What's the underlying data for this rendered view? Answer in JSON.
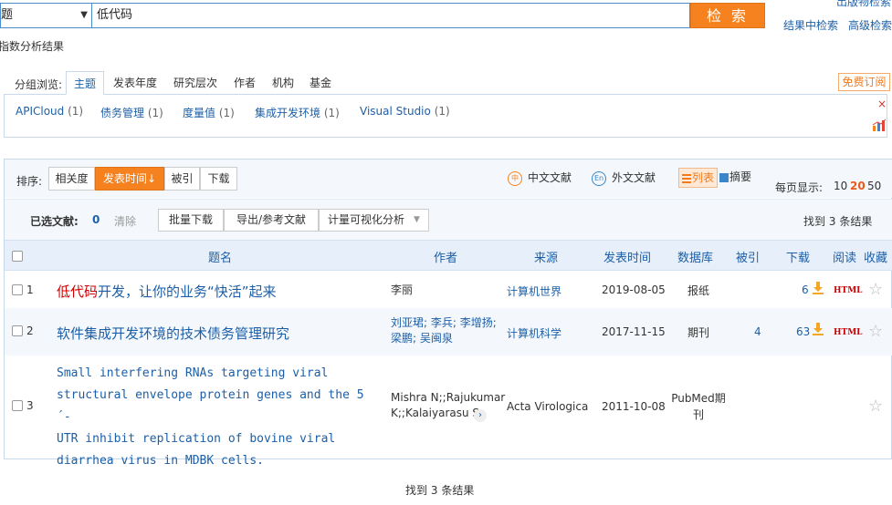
{
  "search": {
    "field": "题",
    "query": "低代码",
    "button": "检 索",
    "top_right": "出版物检索",
    "in_results": "结果中检索",
    "advanced": "高级检索",
    "analysis": "指数分析结果"
  },
  "group": {
    "label": "分组浏览:",
    "tabs": [
      "主题",
      "发表年度",
      "研究层次",
      "作者",
      "机构",
      "基金"
    ],
    "items": [
      {
        "name": "APICloud",
        "count": "(1)"
      },
      {
        "name": "债务管理",
        "count": "(1)"
      },
      {
        "name": "度量值",
        "count": "(1)"
      },
      {
        "name": "集成开发环境",
        "count": "(1)"
      },
      {
        "name": "Visual Studio",
        "count": "(1)"
      }
    ],
    "subscribe": "免费订阅",
    "close": "×"
  },
  "sort": {
    "label": "排序:",
    "options": [
      "相关度",
      "发表时间",
      "被引",
      "下载"
    ],
    "active_arrow": "↓",
    "cn_docs": "中文文献",
    "en_docs": "外文文献",
    "view_list": "列表",
    "view_summary": "摘要",
    "per_page_label": "每页显示:",
    "per_page": [
      "10",
      "20",
      "50"
    ]
  },
  "batch": {
    "selected_label": "已选文献:",
    "selected_count": "0",
    "clear": "清除",
    "buttons": [
      "批量下载",
      "导出/参考文献",
      "计量可视化分析"
    ],
    "found_prefix": "找到",
    "found_count": "3",
    "found_suffix": "条结果"
  },
  "table": {
    "headers": [
      "题名",
      "作者",
      "来源",
      "发表时间",
      "数据库",
      "被引",
      "下载",
      "阅读",
      "收藏"
    ],
    "rows": [
      {
        "num": "1",
        "title_hl": "低代码",
        "title_rest": "开发，让你的业务“快活”起来",
        "authors": "李丽",
        "source": "计算机世界",
        "date": "2019-08-05",
        "db": "报纸",
        "cites": "",
        "downloads": "6",
        "read": "HTML"
      },
      {
        "num": "2",
        "title_hl": "",
        "title_rest": "软件集成开发环境的技术债务管理研究",
        "authors": "刘亚珺; 李兵; 李增扬; 梁鹏; 吴闽泉",
        "source": "计算机科学",
        "date": "2017-11-15",
        "db": "期刊",
        "cites": "4",
        "downloads": "63",
        "read": "HTML"
      },
      {
        "num": "3",
        "title_lines": [
          "Small interfering RNAs targeting viral",
          "structural envelope protein genes and the 5´-",
          "UTR inhibit replication of bovine viral",
          "diarrhea virus in MDBK cells."
        ],
        "authors_lines": [
          "Mishra N;;Rajukumar",
          "K;;Kalaiyarasu S"
        ],
        "more": "›",
        "source": "Acta Virologica",
        "date": "2011-10-08",
        "db_lines": [
          "PubMed期",
          "刊"
        ],
        "cites": "",
        "downloads": "",
        "read": ""
      }
    ],
    "star": "☆"
  },
  "colors": {
    "accent_orange": "#f5821f",
    "link_blue": "#1c5fa8",
    "highlight_red": "#cc0000"
  }
}
